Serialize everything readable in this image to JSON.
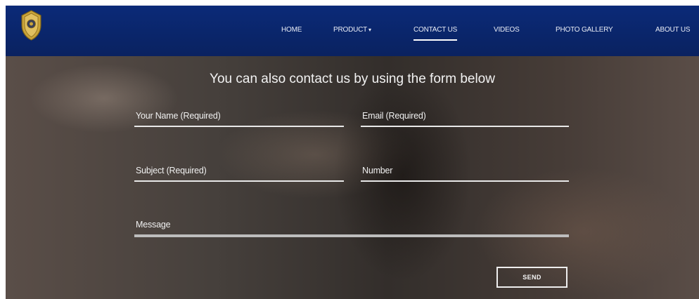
{
  "nav": {
    "items": [
      {
        "label": "HOME"
      },
      {
        "label": "PRODUCT",
        "caret": "▾"
      },
      {
        "label": "CONTACT US"
      },
      {
        "label": "VIDEOS"
      },
      {
        "label": "PHOTO GALLERY"
      },
      {
        "label": "ABOUT US"
      }
    ],
    "active_item": "CONTACT US"
  },
  "contact_form": {
    "heading": "You can also contact us by using the form below",
    "fields": {
      "name": {
        "placeholder": "Your Name (Required)",
        "value": ""
      },
      "email": {
        "placeholder": "Email (Required)",
        "value": ""
      },
      "subject": {
        "placeholder": "Subject (Required)",
        "value": ""
      },
      "number": {
        "placeholder": "Number",
        "value": ""
      },
      "message": {
        "placeholder": "Message",
        "value": ""
      }
    },
    "submit_label": "SEND"
  },
  "colors": {
    "nav_background": "#0b2a78",
    "badge_gold": "#c9a43a",
    "text_light": "#f2f2f2"
  },
  "icons": {
    "logo": "police-badge-icon"
  }
}
